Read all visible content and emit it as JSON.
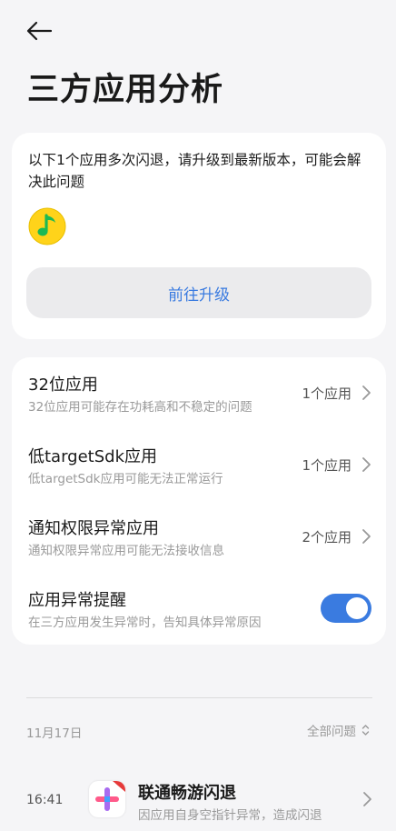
{
  "header": {
    "title": "三方应用分析",
    "back_icon": "arrow-left-icon"
  },
  "upgrade_card": {
    "message": "以下1个应用多次闪退，请升级到最新版本，可能会解决此问题",
    "app_icon": "qq-music-icon",
    "button_label": "前往升级"
  },
  "list": {
    "items": [
      {
        "title": "32位应用",
        "subtitle": "32位应用可能存在功耗高和不稳定的问题",
        "value": "1个应用"
      },
      {
        "title": "低targetSdk应用",
        "subtitle": "低targetSdk应用可能无法正常运行",
        "value": "1个应用"
      },
      {
        "title": "通知权限异常应用",
        "subtitle": "通知权限异常应用可能无法接收信息",
        "value": "2个应用"
      }
    ],
    "toggle_item": {
      "title": "应用异常提醒",
      "subtitle": "在三方应用发生异常时，告知具体异常原因",
      "enabled": true
    }
  },
  "history": {
    "date": "11月17日",
    "filter_label": "全部问题",
    "events": [
      {
        "time": "16:41",
        "title": "联通畅游闪退",
        "subtitle": "因应用自身空指针异常，造成闪退",
        "icon": "unicom-app-icon"
      }
    ]
  },
  "colors": {
    "accent": "#3a7be0",
    "background": "#f5f5f7",
    "card": "#ffffff"
  }
}
